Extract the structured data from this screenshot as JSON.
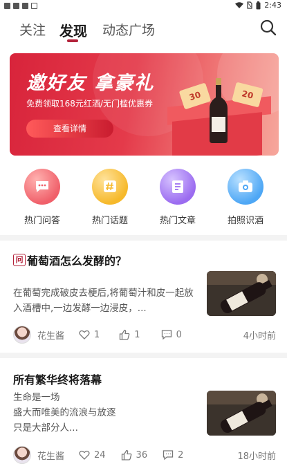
{
  "status_bar": {
    "time": "2:43"
  },
  "tabs": [
    {
      "label": "关注"
    },
    {
      "label": "发现"
    },
    {
      "label": "动态广场"
    }
  ],
  "banner": {
    "title": "邀好友 拿豪礼",
    "subtitle": "免费领取168元红酒/无门槛优惠券",
    "button": "查看详情",
    "coupon_a": "30",
    "coupon_b": "20"
  },
  "quick_entries": [
    {
      "label": "热门问答",
      "icon": "chat-bubble-icon",
      "color": "#f0606a"
    },
    {
      "label": "热门话题",
      "icon": "hashtag-icon",
      "color": "#f6b92b"
    },
    {
      "label": "热门文章",
      "icon": "article-icon",
      "color": "#9b6cf0"
    },
    {
      "label": "拍照识酒",
      "icon": "camera-icon",
      "color": "#4ea7f5"
    }
  ],
  "posts": [
    {
      "badge": "问",
      "title": "葡萄酒怎么发酵的？",
      "body": "在葡萄完成破皮去梗后,将葡萄汁和皮一起放入酒槽中,一边发酵一边浸皮，...",
      "author": "花生酱",
      "likes": "1",
      "thumbs": "1",
      "comments": "0",
      "time": "4小时前"
    },
    {
      "title": "所有繁华终将落幕",
      "body_lines": [
        "生命是一场",
        "盛大而唯美的流浪与放逐",
        "只是大部分人..."
      ],
      "author": "花生酱",
      "likes": "24",
      "thumbs": "36",
      "comments": "2",
      "time": "18小时前"
    }
  ]
}
